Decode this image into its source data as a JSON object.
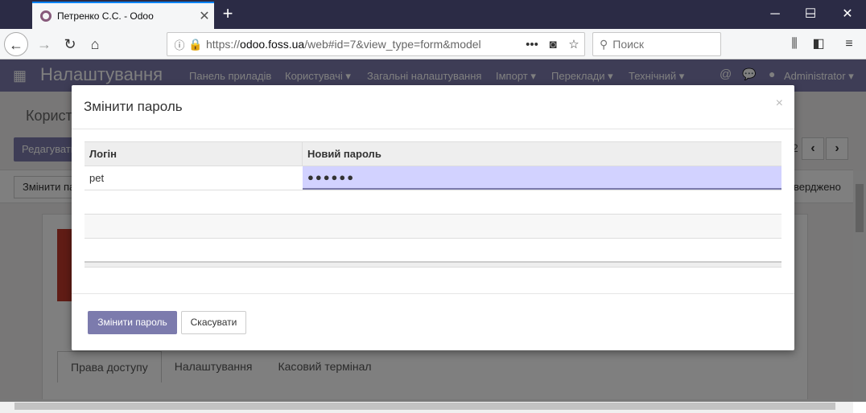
{
  "browser": {
    "tab_title": "Петренко С.С. - Odoo",
    "url_host": "odoo.foss.ua",
    "url_prefix": "https://",
    "url_rest": "/web#id=7&view_type=form&model",
    "search_placeholder": "Поиск",
    "dots": "•••"
  },
  "odoo": {
    "app_title": "Налаштування",
    "menu": [
      "Панель приладів",
      "Користувачі ▾",
      "Загальні налаштування",
      "Імпорт ▾",
      "Переклади ▾",
      "Технічний ▾"
    ],
    "user": "Administrator ▾",
    "breadcrumb": "Корист",
    "edit_button": "Редагувати",
    "change_pw_button_bg": "Змінити па",
    "pager_num": "2",
    "status": "верджено",
    "tabs": [
      "Права доступу",
      "Налаштування",
      "Касовий термінал"
    ]
  },
  "modal": {
    "title": "Змінити пароль",
    "close": "×",
    "columns": [
      "Логін",
      "Новий пароль"
    ],
    "rows": [
      {
        "login": "pet",
        "password": "●●●●●●"
      }
    ],
    "primary_button": "Змінити пароль",
    "cancel_button": "Скасувати"
  }
}
